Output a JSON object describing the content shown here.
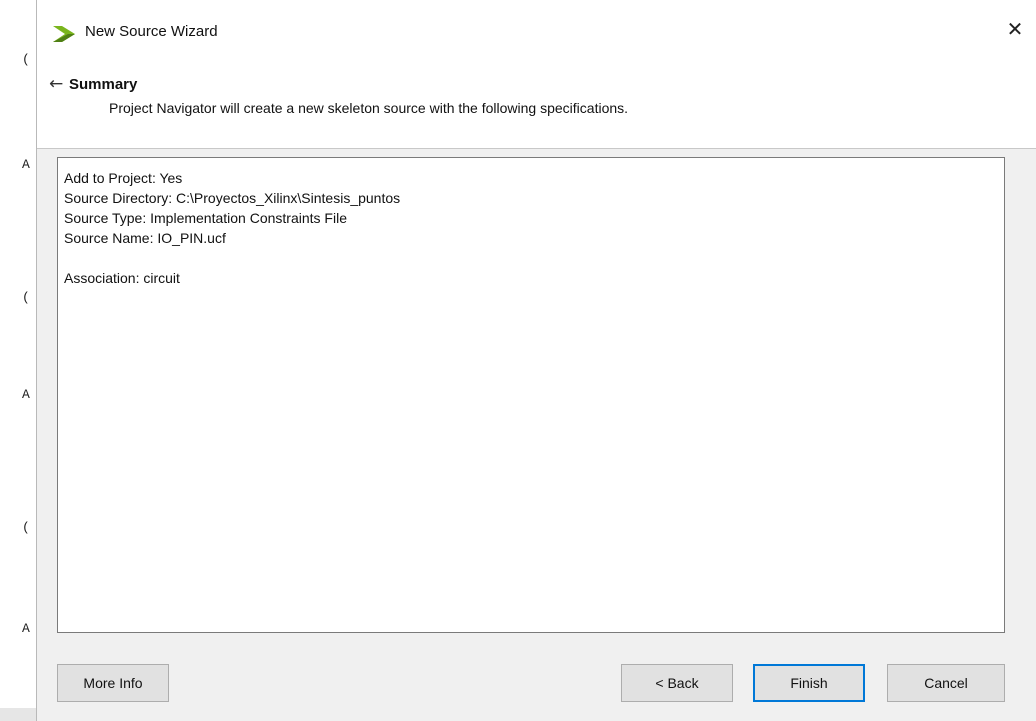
{
  "background": {
    "code_glyphs": [
      "(",
      "A",
      "(",
      "A",
      "(",
      "A"
    ]
  },
  "dialog": {
    "title": "New Source Wizard",
    "close_symbol": "✕",
    "header": {
      "back_symbol": "←",
      "title": "Summary",
      "description": "Project Navigator will create a new skeleton source with the following specifications."
    },
    "summary_lines": [
      "Add to Project: Yes",
      "Source Directory: C:\\Proyectos_Xilinx\\Sintesis_puntos",
      "Source Type: Implementation Constraints File",
      "Source Name: IO_PIN.ucf",
      "",
      "Association: circuit"
    ],
    "buttons": {
      "more_info": "More Info",
      "back": "< Back",
      "finish": "Finish",
      "cancel": "Cancel"
    }
  },
  "colors": {
    "logo_green": "#7ab51d",
    "logo_dark": "#3e6b12",
    "default_button_border": "#0078d7"
  },
  "icons": {
    "title": "xilinx-chevron-logo-icon",
    "close": "close-icon",
    "back": "back-arrow-icon"
  }
}
